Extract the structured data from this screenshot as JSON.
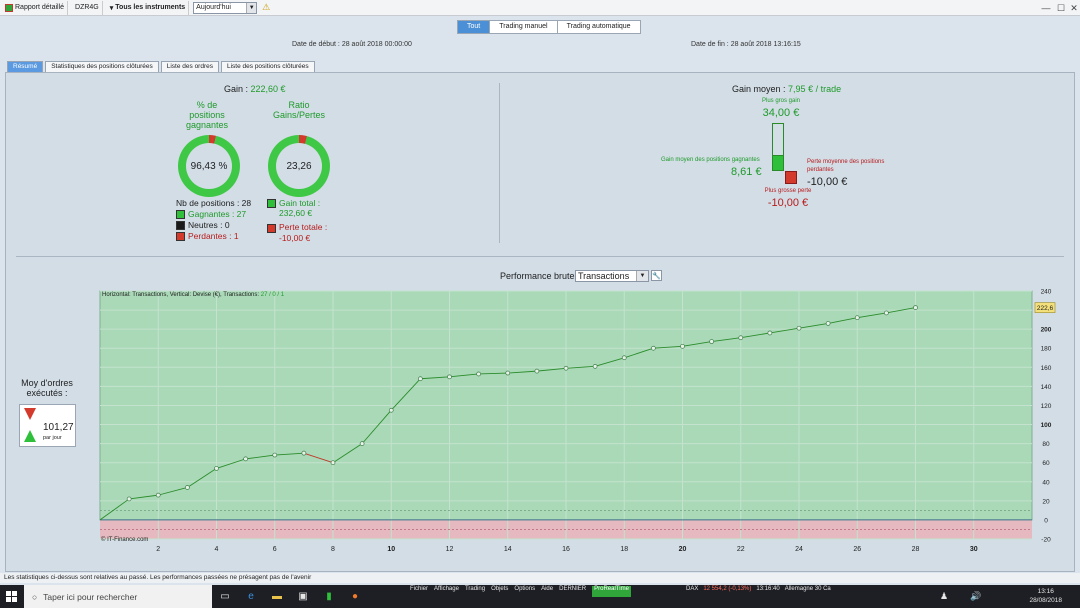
{
  "toolbar": {
    "report": "Rapport détaillé",
    "account": "DZR4G",
    "instruments": "Tous les instruments",
    "period": "Aujourd'hui"
  },
  "filters": [
    {
      "label": "Tout",
      "active": true
    },
    {
      "label": "Trading manuel",
      "active": false
    },
    {
      "label": "Trading automatique",
      "active": false
    }
  ],
  "dates": {
    "start": "Date de début : 28 août 2018 00:00:00",
    "end": "Date de fin : 28 août 2018 13:16:15"
  },
  "tabs": [
    {
      "label": "Résumé",
      "active": true
    },
    {
      "label": "Statistiques des positions clôturées",
      "active": false
    },
    {
      "label": "Liste des ordres",
      "active": false
    },
    {
      "label": "Liste des positions clôturées",
      "active": false
    }
  ],
  "summary": {
    "gain_label": "Gain :",
    "gain_value": "222,60 €",
    "win_title_1": "% de",
    "win_title_2": "positions",
    "win_title_3": "gagnantes",
    "win_pct": "96,43 %",
    "win_fraction": 0.9643,
    "ratio_title_1": "Ratio",
    "ratio_title_2": "Gains/Pertes",
    "ratio_value": "23,26",
    "ratio_fraction": 0.9588,
    "nb_positions": "Nb de positions : 28",
    "gagnantes": "Gagnantes : 27",
    "neutres": "Neutres : 0",
    "perdantes": "Perdantes : 1",
    "gain_total_label": "Gain total :",
    "gain_total_value": "232,60 €",
    "perte_totale_label": "Perte totale :",
    "perte_totale_value": "-10,00 €"
  },
  "avg": {
    "title_label": "Gain moyen :",
    "title_value": "7,95 € / trade",
    "best_label": "Plus gros gain",
    "best_value": "34,00 €",
    "avg_win_label": "Gain moyen des positions gagnantes",
    "avg_win_value": "8,61 €",
    "avg_loss_label": "Perte moyenne des positions perdantes",
    "avg_loss_value": "-10,00 €",
    "worst_label": "Plus grosse perte",
    "worst_value": "-10,00 €"
  },
  "orders": {
    "label_1": "Moy d'ordres",
    "label_2": "exécutés :",
    "value": "101,27",
    "unit": "par jour"
  },
  "perf": {
    "title": "Performance brute",
    "select": "Transactions",
    "info_prefix": "Horizontal: Transactions, Vertical: Devise (€), Transactions: ",
    "info_counts": "27 / 0 / 1",
    "watermark": "© IT-Finance.com"
  },
  "chart_data": {
    "type": "line",
    "x": [
      0,
      1,
      2,
      3,
      4,
      5,
      6,
      7,
      8,
      9,
      10,
      11,
      12,
      13,
      14,
      15,
      16,
      17,
      18,
      19,
      20,
      21,
      22,
      23,
      24,
      25,
      26,
      27,
      28
    ],
    "values": [
      0,
      22,
      26,
      34,
      54,
      64,
      68,
      70,
      60,
      80,
      115,
      148,
      150,
      153,
      154,
      156,
      159,
      161,
      170,
      180,
      182,
      187,
      191,
      196,
      201,
      206,
      212,
      217,
      222.6
    ],
    "loss_segment_index": 7,
    "xlim": [
      0,
      32
    ],
    "ylim": [
      -20,
      240
    ],
    "x_ticks": [
      2,
      4,
      6,
      8,
      10,
      12,
      14,
      16,
      18,
      20,
      22,
      24,
      26,
      28,
      30
    ],
    "y_ticks": [
      240,
      220,
      200,
      180,
      160,
      140,
      120,
      100,
      80,
      60,
      40,
      20,
      0,
      -20
    ],
    "last_label": "222,6",
    "colors": {
      "area": "#a9d9b7",
      "line_gain": "#2b8c2b",
      "line_loss": "#c0392b",
      "neg_band": "#e5b9bf"
    }
  },
  "status": "Les statistiques ci-dessus sont relatives au passé. Les performances passées ne présagent pas de l'avenir",
  "taskbar": {
    "search": "Taper ici pour rechercher",
    "menu": [
      "Fichier",
      "Affichage",
      "Trading",
      "Objets",
      "Options",
      "Aide",
      "DERNIER",
      "ProRealTime"
    ],
    "dax": "DAX",
    "dax_quote": "12 554,2 (-0,13%)",
    "dax_time": "13:16:40",
    "dax_tail": "Allemagne 30 Ca",
    "time": "13:16",
    "date": "28/08/2018"
  }
}
